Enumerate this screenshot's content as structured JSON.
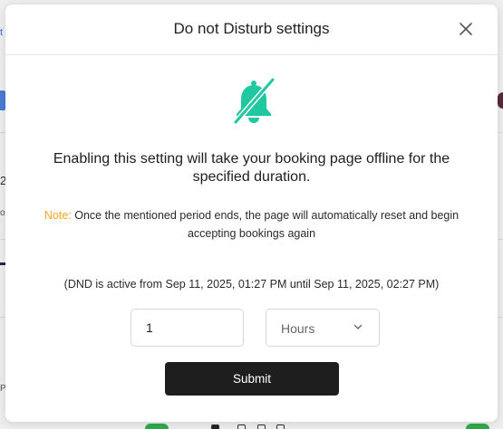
{
  "background": {
    "left_fragment_text": "t",
    "left_heading_fragment": "2",
    "left_small_fragment": "o",
    "left_bottom_fragment": "P"
  },
  "modal": {
    "title": "Do not Disturb settings",
    "close_icon": "close-icon",
    "bell_icon": "bell-off-icon",
    "bell_color": "#1fc8a0",
    "headline": "Enabling this setting will take your booking page offline for the specified duration.",
    "note_label": "Note:",
    "note_label_color": "#f5a623",
    "note_text": " Once the mentioned period ends, the page will automatically reset and begin accepting bookings again",
    "dnd_status": "(DND is active from Sep 11, 2025, 01:27 PM until Sep 11, 2025, 02:27 PM)",
    "duration_value": "1",
    "unit_selected": "Hours",
    "submit_label": "Submit"
  }
}
